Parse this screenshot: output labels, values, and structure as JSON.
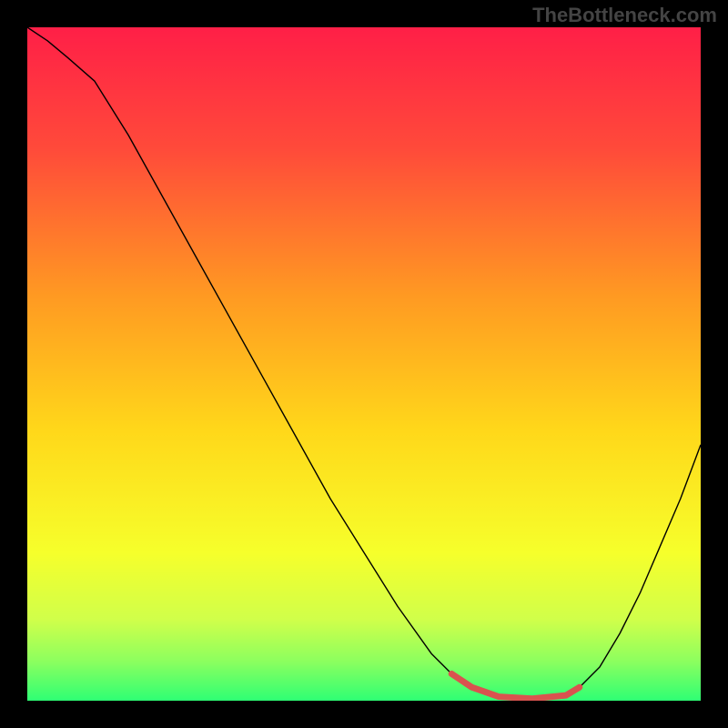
{
  "watermark": "TheBottleneck.com",
  "chart_data": {
    "type": "line",
    "title": "",
    "xlabel": "",
    "ylabel": "",
    "xlim": [
      0,
      100
    ],
    "ylim": [
      0,
      100
    ],
    "grid": false,
    "series": [
      {
        "name": "curve",
        "stroke": "#000000",
        "stroke_width": 1.4,
        "x": [
          0,
          3,
          6,
          10,
          15,
          20,
          25,
          30,
          35,
          40,
          45,
          50,
          55,
          60,
          63,
          66,
          70,
          75,
          80,
          82,
          85,
          88,
          91,
          94,
          97,
          100
        ],
        "y": [
          100,
          98,
          95.5,
          92,
          84,
          75,
          66,
          57,
          48,
          39,
          30,
          22,
          14,
          7,
          4,
          2,
          0.6,
          0.3,
          0.8,
          2,
          5,
          10,
          16,
          23,
          30,
          38
        ]
      },
      {
        "name": "highlight-band",
        "stroke": "#d9534f",
        "stroke_width": 7,
        "linecap": "round",
        "x": [
          63,
          66,
          70,
          75,
          80,
          82
        ],
        "y": [
          4,
          2,
          0.6,
          0.3,
          0.8,
          2
        ]
      }
    ],
    "background_gradient": {
      "stops": [
        {
          "offset": 0.0,
          "color": "#ff1f47"
        },
        {
          "offset": 0.18,
          "color": "#ff4a3a"
        },
        {
          "offset": 0.4,
          "color": "#ff9a22"
        },
        {
          "offset": 0.6,
          "color": "#ffd81a"
        },
        {
          "offset": 0.78,
          "color": "#f6ff2b"
        },
        {
          "offset": 0.88,
          "color": "#d0ff4a"
        },
        {
          "offset": 0.94,
          "color": "#8eff5e"
        },
        {
          "offset": 1.0,
          "color": "#2eff74"
        }
      ]
    }
  }
}
